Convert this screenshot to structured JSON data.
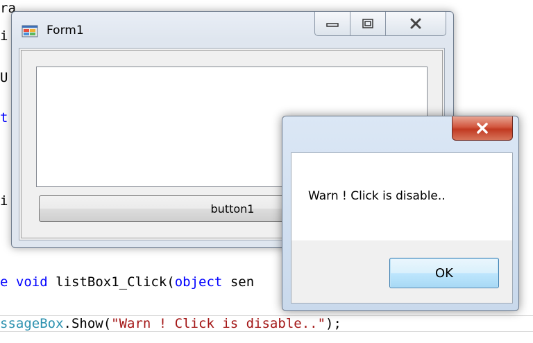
{
  "code_editor": {
    "fragments": [
      "ra",
      "i",
      "U",
      "t",
      "i"
    ],
    "method_line": {
      "modifier_tail": "e",
      "return_type": "void",
      "method_name": "listBox1_Click(",
      "param_type": "object",
      "param_name": "sen"
    },
    "call_line": {
      "class_tail": "ssageBox",
      "call": ".Show(",
      "argument": "\"Warn ! Click is disable..\"",
      "end": ");"
    }
  },
  "form1": {
    "title": "Form1",
    "app_icon": "winforms-app-icon",
    "button1_label": "button1",
    "caption_buttons": [
      "minimize-icon",
      "maximize-icon",
      "close-icon"
    ]
  },
  "message_box": {
    "message": "Warn ! Click is disable..",
    "ok_label": "OK",
    "close_icon": "close-icon"
  },
  "colors": {
    "keyword": "#0000ff",
    "string": "#a31515",
    "type": "#2b91af",
    "ok_button_border": "#3c7fb1",
    "close_button_red": "#c13a22"
  }
}
